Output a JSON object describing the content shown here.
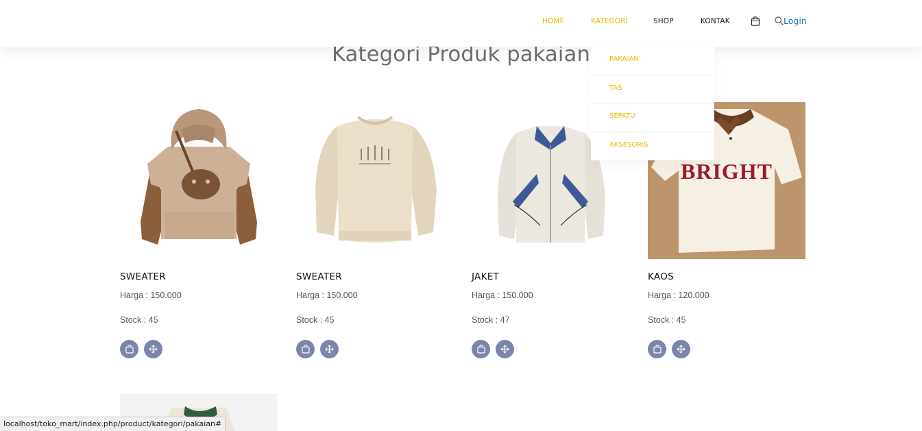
{
  "nav": {
    "home": "HOME",
    "kategori": "KATEGORI",
    "shop": "SHOP",
    "kontak": "KONTAK",
    "bag_icon": "shopping-bag-icon",
    "search_icon": "search-icon",
    "login": "Login",
    "active_color": "#f1b800",
    "login_color": "#1e73be"
  },
  "dropdown": {
    "items": [
      "PAKAIAN",
      "TAS",
      "SEPATU",
      "AKSESORIS"
    ]
  },
  "page": {
    "title": "Kategori Produk pakaian"
  },
  "products": [
    {
      "name": "SWEATER",
      "price": "Harga : 150.000",
      "stock": "Stock : 45"
    },
    {
      "name": "SWEATER",
      "price": "Harga : 150.000",
      "stock": "Stock : 45"
    },
    {
      "name": "JAKET",
      "price": "Harga : 150.000",
      "stock": "Stock : 47"
    },
    {
      "name": "KAOS",
      "price": "Harga : 120.000",
      "stock": "Stock : 45"
    }
  ],
  "product_images": {
    "kaos_print": "BRIGHT"
  },
  "buttons": {
    "cart_icon": "shopping-bag-icon",
    "move_icon": "move-arrows-icon",
    "color": "#7a85ac"
  },
  "status_bar": {
    "url": "localhost/toko_mart/index.php/product/kategori/pakaian#"
  }
}
